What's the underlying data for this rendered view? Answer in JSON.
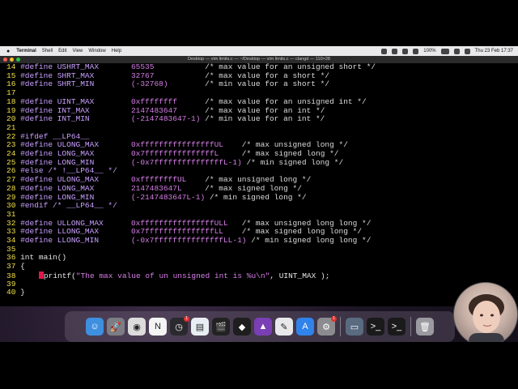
{
  "menubar": {
    "app": "Terminal",
    "items": [
      "Shell",
      "Edit",
      "View",
      "Window",
      "Help"
    ],
    "battery": "100%",
    "clock": "Thu 23 Feb  17:37"
  },
  "window": {
    "title": "Desktop — vim limits.c — ~/Desktop — vim limits.c — clangd — 110×28"
  },
  "code": [
    {
      "n": "14",
      "parts": [
        [
          "pp",
          "#define USHRT_MAX"
        ],
        [
          "",
          "       "
        ],
        [
          "num",
          "65535"
        ],
        [
          "",
          "           "
        ],
        [
          "cm",
          "/* max value for an unsigned short */"
        ]
      ]
    },
    {
      "n": "15",
      "parts": [
        [
          "pp",
          "#define SHRT_MAX"
        ],
        [
          "",
          "        "
        ],
        [
          "num",
          "32767"
        ],
        [
          "",
          "           "
        ],
        [
          "cm",
          "/* max value for a short */"
        ]
      ]
    },
    {
      "n": "16",
      "parts": [
        [
          "pp",
          "#define SHRT_MIN"
        ],
        [
          "",
          "        "
        ],
        [
          "num",
          "(-32768)"
        ],
        [
          "",
          "        "
        ],
        [
          "cm",
          "/* min value for a short */"
        ]
      ]
    },
    {
      "n": "17",
      "parts": []
    },
    {
      "n": "18",
      "parts": [
        [
          "pp",
          "#define UINT_MAX"
        ],
        [
          "",
          "        "
        ],
        [
          "num",
          "0xffffffff"
        ],
        [
          "",
          "      "
        ],
        [
          "cm",
          "/* max value for an unsigned int */"
        ]
      ]
    },
    {
      "n": "19",
      "parts": [
        [
          "pp",
          "#define INT_MAX"
        ],
        [
          "",
          "         "
        ],
        [
          "num",
          "2147483647"
        ],
        [
          "",
          "      "
        ],
        [
          "cm",
          "/* max value for an int */"
        ]
      ]
    },
    {
      "n": "20",
      "parts": [
        [
          "pp",
          "#define INT_MIN"
        ],
        [
          "",
          "         "
        ],
        [
          "num",
          "(-2147483647-1)"
        ],
        [
          "",
          " "
        ],
        [
          "cm",
          "/* min value for an int */"
        ]
      ]
    },
    {
      "n": "21",
      "parts": []
    },
    {
      "n": "22",
      "parts": [
        [
          "pp",
          "#ifdef __LP64__"
        ]
      ]
    },
    {
      "n": "23",
      "parts": [
        [
          "pp",
          "#define ULONG_MAX"
        ],
        [
          "",
          "       "
        ],
        [
          "num",
          "0xffffffffffffffffUL"
        ],
        [
          "",
          "    "
        ],
        [
          "cm",
          "/* max unsigned long */"
        ]
      ]
    },
    {
      "n": "24",
      "parts": [
        [
          "pp",
          "#define LONG_MAX"
        ],
        [
          "",
          "        "
        ],
        [
          "num",
          "0x7fffffffffffffffL"
        ],
        [
          "",
          "     "
        ],
        [
          "cm",
          "/* max signed long */"
        ]
      ]
    },
    {
      "n": "25",
      "parts": [
        [
          "pp",
          "#define LONG_MIN"
        ],
        [
          "",
          "        "
        ],
        [
          "num",
          "(-0x7fffffffffffffffL-1)"
        ],
        [
          "",
          " "
        ],
        [
          "cm",
          "/* min signed long */"
        ]
      ]
    },
    {
      "n": "26",
      "parts": [
        [
          "pp",
          "#else /* !__LP64__ */"
        ]
      ]
    },
    {
      "n": "27",
      "parts": [
        [
          "pp",
          "#define ULONG_MAX"
        ],
        [
          "",
          "       "
        ],
        [
          "num",
          "0xffffffffUL"
        ],
        [
          "",
          "    "
        ],
        [
          "cm",
          "/* max unsigned long */"
        ]
      ]
    },
    {
      "n": "28",
      "parts": [
        [
          "pp",
          "#define LONG_MAX"
        ],
        [
          "",
          "        "
        ],
        [
          "num",
          "2147483647L"
        ],
        [
          "",
          "     "
        ],
        [
          "cm",
          "/* max signed long */"
        ]
      ]
    },
    {
      "n": "29",
      "parts": [
        [
          "pp",
          "#define LONG_MIN"
        ],
        [
          "",
          "        "
        ],
        [
          "num",
          "(-2147483647L-1)"
        ],
        [
          "",
          " "
        ],
        [
          "cm",
          "/* min signed long */"
        ]
      ]
    },
    {
      "n": "30",
      "parts": [
        [
          "pp",
          "#endif /* __LP64__ */"
        ]
      ]
    },
    {
      "n": "31",
      "parts": []
    },
    {
      "n": "32",
      "parts": [
        [
          "pp",
          "#define ULLONG_MAX"
        ],
        [
          "",
          "      "
        ],
        [
          "num",
          "0xffffffffffffffffULL"
        ],
        [
          "",
          "   "
        ],
        [
          "cm",
          "/* max unsigned long long */"
        ]
      ]
    },
    {
      "n": "33",
      "parts": [
        [
          "pp",
          "#define LLONG_MAX"
        ],
        [
          "",
          "       "
        ],
        [
          "num",
          "0x7fffffffffffffffLL"
        ],
        [
          "",
          "    "
        ],
        [
          "cm",
          "/* max signed long long */"
        ]
      ]
    },
    {
      "n": "34",
      "parts": [
        [
          "pp",
          "#define LLONG_MIN"
        ],
        [
          "",
          "       "
        ],
        [
          "num",
          "(-0x7fffffffffffffffLL-1)"
        ],
        [
          "",
          " "
        ],
        [
          "cm",
          "/* min signed long long */"
        ]
      ]
    },
    {
      "n": "35",
      "parts": []
    },
    {
      "n": "36",
      "parts": [
        [
          "",
          "int main()"
        ]
      ]
    },
    {
      "n": "37",
      "parts": [
        [
          "",
          "{"
        ]
      ]
    },
    {
      "n": "38",
      "parts": [
        [
          "",
          "    "
        ],
        [
          "cursor",
          ""
        ],
        [
          "",
          "printf("
        ],
        [
          "str",
          "\"The max value of un unsigned int is %u\\n\""
        ],
        [
          "",
          ", UINT_MAX );"
        ]
      ]
    },
    {
      "n": "39",
      "parts": []
    },
    {
      "n": "40",
      "parts": [
        [
          "",
          "}"
        ]
      ]
    }
  ],
  "dock": [
    {
      "name": "finder-icon",
      "color": "#3f8fe0",
      "glyph": "☺"
    },
    {
      "name": "launchpad-icon",
      "color": "#7d7d85",
      "glyph": "🚀"
    },
    {
      "name": "chrome-icon",
      "color": "#dcdcdc",
      "glyph": "◉"
    },
    {
      "name": "notion-icon",
      "color": "#f4f4f4",
      "glyph": "N"
    },
    {
      "name": "clock-app-icon",
      "color": "#2a2a2e",
      "glyph": "◷",
      "badge": "1"
    },
    {
      "name": "preview-icon",
      "color": "#e8edf3",
      "glyph": "▤"
    },
    {
      "name": "final-cut-icon",
      "color": "#222",
      "glyph": "🎬"
    },
    {
      "name": "figma-icon",
      "color": "#1e1e1e",
      "glyph": "◆"
    },
    {
      "name": "affinity-icon",
      "color": "#7b3fb5",
      "glyph": "▲"
    },
    {
      "name": "notes-app-icon",
      "color": "#e8e8ea",
      "glyph": "✎"
    },
    {
      "name": "app-store-icon",
      "color": "#2f83ea",
      "glyph": "A"
    },
    {
      "name": "system-preferences-icon",
      "color": "#8c8c90",
      "glyph": "⚙",
      "badge": "1"
    },
    {
      "name": "sep"
    },
    {
      "name": "screenshot-app-icon",
      "color": "#5a6b80",
      "glyph": "▭"
    },
    {
      "name": "terminal-icon",
      "color": "#1a1a1a",
      "glyph": ">_"
    },
    {
      "name": "terminal-window-icon",
      "color": "#1a1a1a",
      "glyph": ">_"
    },
    {
      "name": "sep"
    },
    {
      "name": "trash-icon",
      "color": "#9a9aa0",
      "glyph": "🗑"
    }
  ]
}
